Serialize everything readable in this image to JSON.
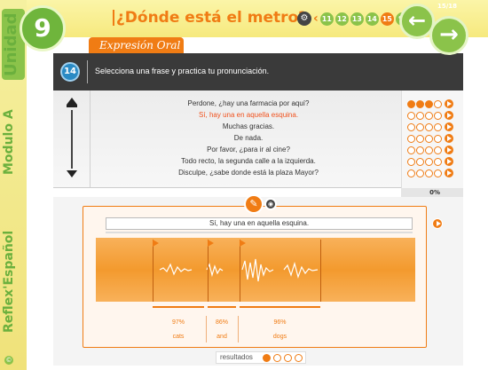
{
  "sidebar": {
    "unidad": "Unidad",
    "modulo": "Modulo A",
    "product": "Reflex'Español"
  },
  "header": {
    "unit_number": "9",
    "title": "¿Dónde está el metro?",
    "page_count": "15/18",
    "pages": [
      "11",
      "12",
      "13",
      "14",
      "15",
      "%"
    ],
    "active_page": "15"
  },
  "section_tab": "Expresión Oral",
  "instruction": {
    "number": "14",
    "text": "Selecciona una frase y practica tu pronunciación."
  },
  "phrases": [
    {
      "text": "Perdone, ¿hay una farmacia por aquí?",
      "selected": false,
      "score_dots": 3
    },
    {
      "text": "Sí, hay una en aquella esquina.",
      "selected": true,
      "score_dots": 0
    },
    {
      "text": "Muchas gracias.",
      "selected": false,
      "score_dots": 0
    },
    {
      "text": "De nada.",
      "selected": false,
      "score_dots": 0
    },
    {
      "text": "Por favor, ¿para ir al cine?",
      "selected": false,
      "score_dots": 0
    },
    {
      "text": "Todo recto, la segunda calle a la izquierda.",
      "selected": false,
      "score_dots": 0
    },
    {
      "text": "Disculpe, ¿sabe donde está la plaza Mayor?",
      "selected": false,
      "score_dots": 0
    }
  ],
  "overall_percent": "0%",
  "recording": {
    "sentence": "Sí, hay una en aquella esquina.",
    "segments": [
      {
        "score": "97%",
        "word": "cats"
      },
      {
        "score": "86%",
        "word": "and"
      },
      {
        "score": "96%",
        "word": "dogs"
      }
    ]
  },
  "results": {
    "label": "resultados",
    "filled": 1,
    "total": 4
  },
  "colors": {
    "accent": "#f07c14",
    "green": "#8bc34a",
    "dark": "#3a3a3a",
    "selected_text": "#f0521e"
  }
}
